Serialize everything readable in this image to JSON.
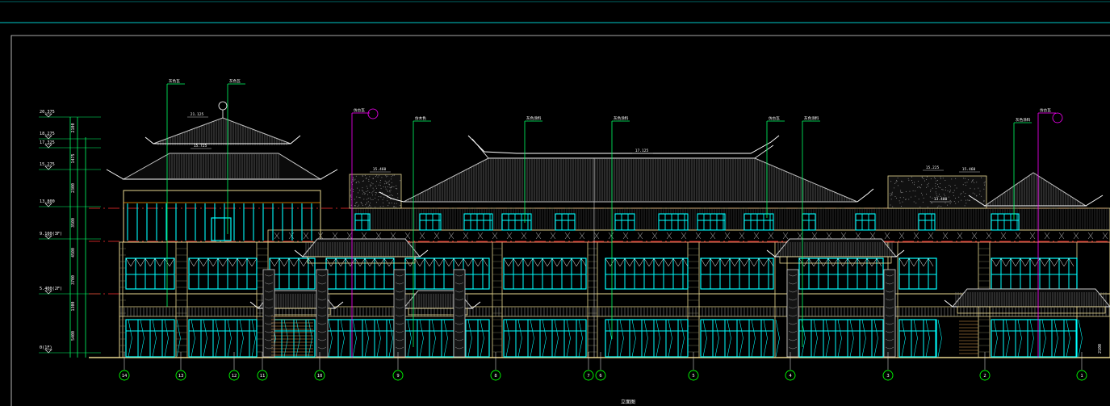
{
  "colors": {
    "background": "#000000",
    "frame": "#00c8c8",
    "glazing": "#00ffff",
    "structure": "#e8d890",
    "roof": "#c8c8c8",
    "grid_bubble": "#00ff00",
    "level_line_red": "#ff3030",
    "leader_magenta": "#ff00ff",
    "leader_green": "#00ff66",
    "dim_text": "#ffffff"
  },
  "level_labels": [
    "20.375",
    "18.275",
    "17.325",
    "15.275",
    "13.800",
    "9.100(3F)",
    "5.400(2F)",
    "0(1F)"
  ],
  "dimension_labels": [
    "2100",
    "1475",
    "2300",
    "3500",
    "4500",
    "3700",
    "1300",
    "5400"
  ],
  "grid_axis_labels": [
    "14",
    "13",
    "12",
    "11",
    "10",
    "9",
    "8",
    "7",
    "6",
    "5",
    "4",
    "3",
    "2",
    "1"
  ],
  "roof_annotations": [
    "21.125",
    "17.125",
    "15.725",
    "15.460",
    "15.460",
    "15.225",
    "13.400"
  ],
  "callout_texts": [
    "灰色瓦",
    "灰色瓦",
    "仿古瓦",
    "仿木色",
    "灰色涂料",
    "灰色涂料",
    "仿古瓦",
    "灰色涂料",
    "灰色涂料",
    "仿古瓦"
  ],
  "sheet_title": "立面图",
  "right_dimension": "2100"
}
